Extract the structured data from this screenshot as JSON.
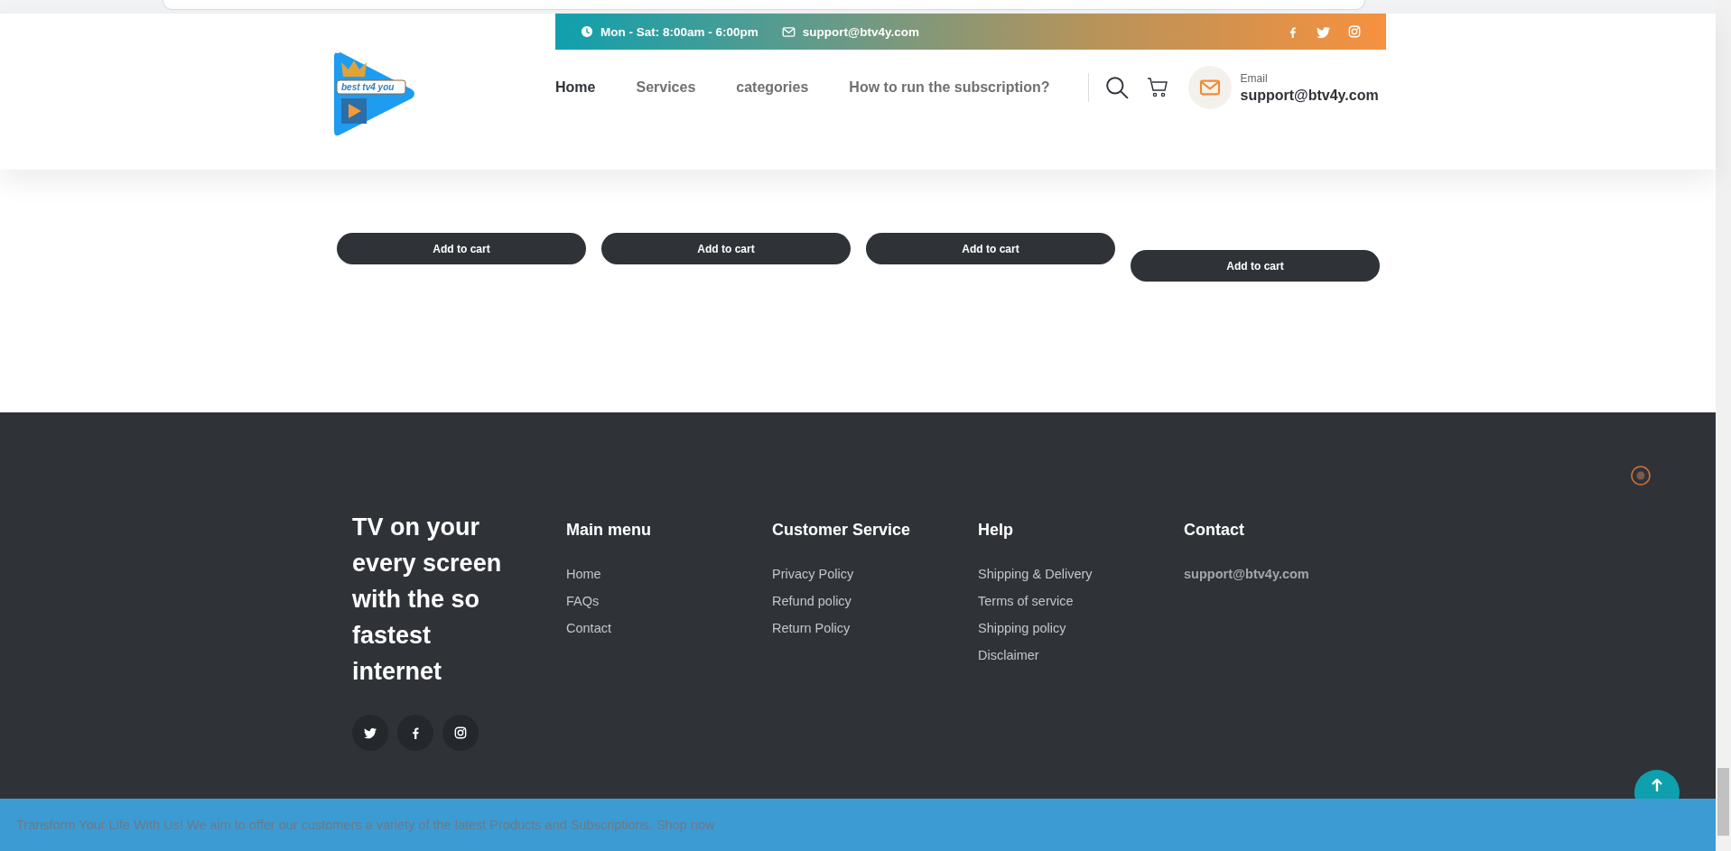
{
  "top_bar": {
    "hours": "Mon - Sat: 8:00am - 6:00pm",
    "email": "support@btv4y.com"
  },
  "logo": {
    "text": "best tv4 you"
  },
  "nav": [
    {
      "label": "Home",
      "selected": true
    },
    {
      "label": "Services",
      "selected": false
    },
    {
      "label": "categories",
      "selected": false
    },
    {
      "label": "How to run the subscription?",
      "selected": false
    }
  ],
  "header_contact": {
    "label": "Email",
    "value": "support@btv4y.com"
  },
  "products": [
    {
      "button": "Add to cart"
    },
    {
      "button": "Add to cart"
    },
    {
      "button": "Add to cart"
    },
    {
      "button": "Add to cart"
    }
  ],
  "footer": {
    "tagline": "TV on your every screen with the so fastest internet",
    "columns": [
      {
        "title": "Main menu",
        "links": [
          "Home",
          "FAQs",
          "Contact"
        ]
      },
      {
        "title": "Customer Service",
        "links": [
          "Privacy Policy",
          "Refund policy",
          "Return Policy"
        ]
      },
      {
        "title": "Help",
        "links": [
          "Shipping & Delivery",
          "Terms of service",
          "Shipping policy",
          "Disclaimer"
        ]
      },
      {
        "title": "Contact",
        "links": [
          "support@btv4y.com"
        ]
      }
    ]
  },
  "promo_bar": {
    "text": "Transform Your Life With Us! We aim to offer our customers a variety of the latest Products and Subscriptions. Shop now"
  }
}
